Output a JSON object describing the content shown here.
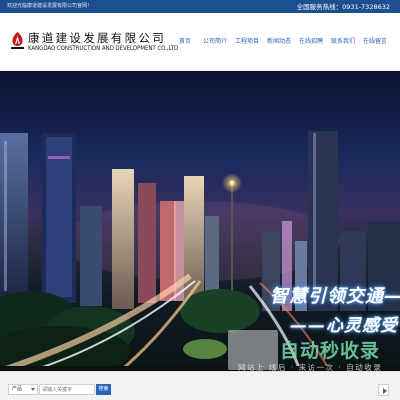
{
  "topbar": {
    "welcome": "欢迎光临康道建设发展有限公司官网！",
    "hotline": "全国服务热线：0931-7328632"
  },
  "brand": {
    "name_cn": "康道建设发展有限公司",
    "name_en": "KANGDAO CONSTRUCTION AND DEVELOPMENT CO.,LTD",
    "logo_color": "#c8161d"
  },
  "nav": [
    {
      "label": "首页",
      "name": "home"
    },
    {
      "label": "公司简介",
      "name": "about"
    },
    {
      "label": "工程项目",
      "name": "projects"
    },
    {
      "label": "新闻动态",
      "name": "news"
    },
    {
      "label": "在线招聘",
      "name": "jobs"
    },
    {
      "label": "联系我们",
      "name": "contact"
    },
    {
      "label": "在线留言",
      "name": "message"
    }
  ],
  "banner": {
    "slogan_line1": "智慧引领交通——",
    "slogan_line2": "——心灵感受"
  },
  "watermark": {
    "title": "自动秒收录",
    "subtitle": "网站上 线后 · 来访一次 · 自动收录"
  },
  "search": {
    "category": "产品",
    "placeholder": "请输入关键字",
    "button": "搜索"
  },
  "colors": {
    "topbar": "#1c4f8f",
    "nav_text": "#2b63b2",
    "button": "#2a66b8"
  }
}
